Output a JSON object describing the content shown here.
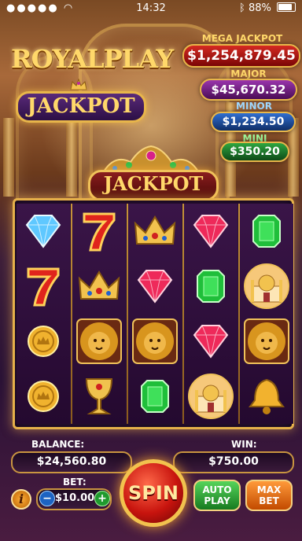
{
  "status_bar": {
    "time": "14:32",
    "battery": "88%"
  },
  "logo": {
    "title": "ROYALPLAY",
    "subtitle": "JACKPOT"
  },
  "jackpots": [
    {
      "label": "MEGA JACKPOT",
      "value": "$1,254,879.45",
      "color": "#c8161a"
    },
    {
      "label": "MAJOR",
      "value": "$45,670.32",
      "color": "#7a1f8a"
    },
    {
      "label": "MINOR",
      "value": "$1,234.50",
      "color": "#1b4f9e"
    },
    {
      "label": "MINI",
      "value": "$350.20",
      "color": "#1d7a2c"
    }
  ],
  "machine": {
    "banner": "JACKPOT"
  },
  "reels": [
    [
      "diamond",
      "seven",
      "coin",
      "coin"
    ],
    [
      "seven",
      "crown",
      "lion",
      "chalice"
    ],
    [
      "crown",
      "ruby",
      "lion",
      "emerald"
    ],
    [
      "ruby",
      "emerald",
      "ruby",
      "palace"
    ],
    [
      "emerald",
      "palace",
      "lion",
      "bell"
    ]
  ],
  "footer": {
    "balance_label": "BALANCE:",
    "balance_value": "$24,560.80",
    "win_label": "WIN:",
    "win_value": "$750.00",
    "bet_label": "BET:",
    "bet_value": "$10.00",
    "info": "i",
    "minus": "−",
    "plus": "+",
    "spin": "SPIN",
    "auto_play": "AUTO PLAY",
    "max_bet": "MAX BET"
  }
}
